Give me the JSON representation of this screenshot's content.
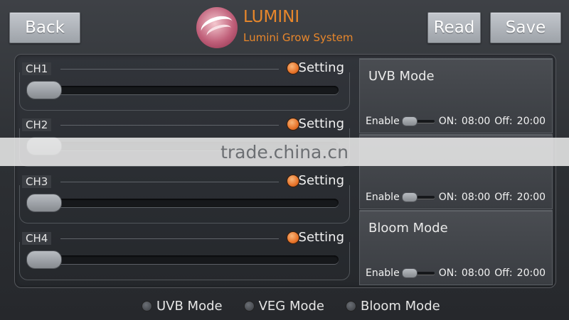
{
  "header": {
    "back_label": "Back",
    "read_label": "Read",
    "save_label": "Save",
    "brand_name": "LUMINI",
    "brand_subtitle": "Lumini Grow System"
  },
  "channels": [
    {
      "label": "CH1",
      "setting_label": "Setting",
      "slider_value": 0
    },
    {
      "label": "CH2",
      "setting_label": "Setting",
      "slider_value": 0
    },
    {
      "label": "CH3",
      "setting_label": "Setting",
      "slider_value": 0
    },
    {
      "label": "CH4",
      "setting_label": "Setting",
      "slider_value": 0
    }
  ],
  "modes": [
    {
      "title": "UVB Mode",
      "enable_label": "Enable",
      "on_label": "ON:",
      "on_time": "08:00",
      "off_label": "Off:",
      "off_time": "20:00"
    },
    {
      "title": "",
      "enable_label": "Enable",
      "on_label": "ON:",
      "on_time": "08:00",
      "off_label": "Off:",
      "off_time": "20:00"
    },
    {
      "title": "Bloom Mode",
      "enable_label": "Enable",
      "on_label": "ON:",
      "on_time": "08:00",
      "off_label": "Off:",
      "off_time": "20:00"
    }
  ],
  "watermark": "trade.china.cn",
  "mode_selector": [
    {
      "label": "UVB Mode"
    },
    {
      "label": "VEG Mode"
    },
    {
      "label": "Bloom Mode"
    }
  ],
  "colors": {
    "accent": "#e8872b",
    "indicator": "#e8742a"
  },
  "icons": {
    "logo": "lumini-logo-icon"
  }
}
